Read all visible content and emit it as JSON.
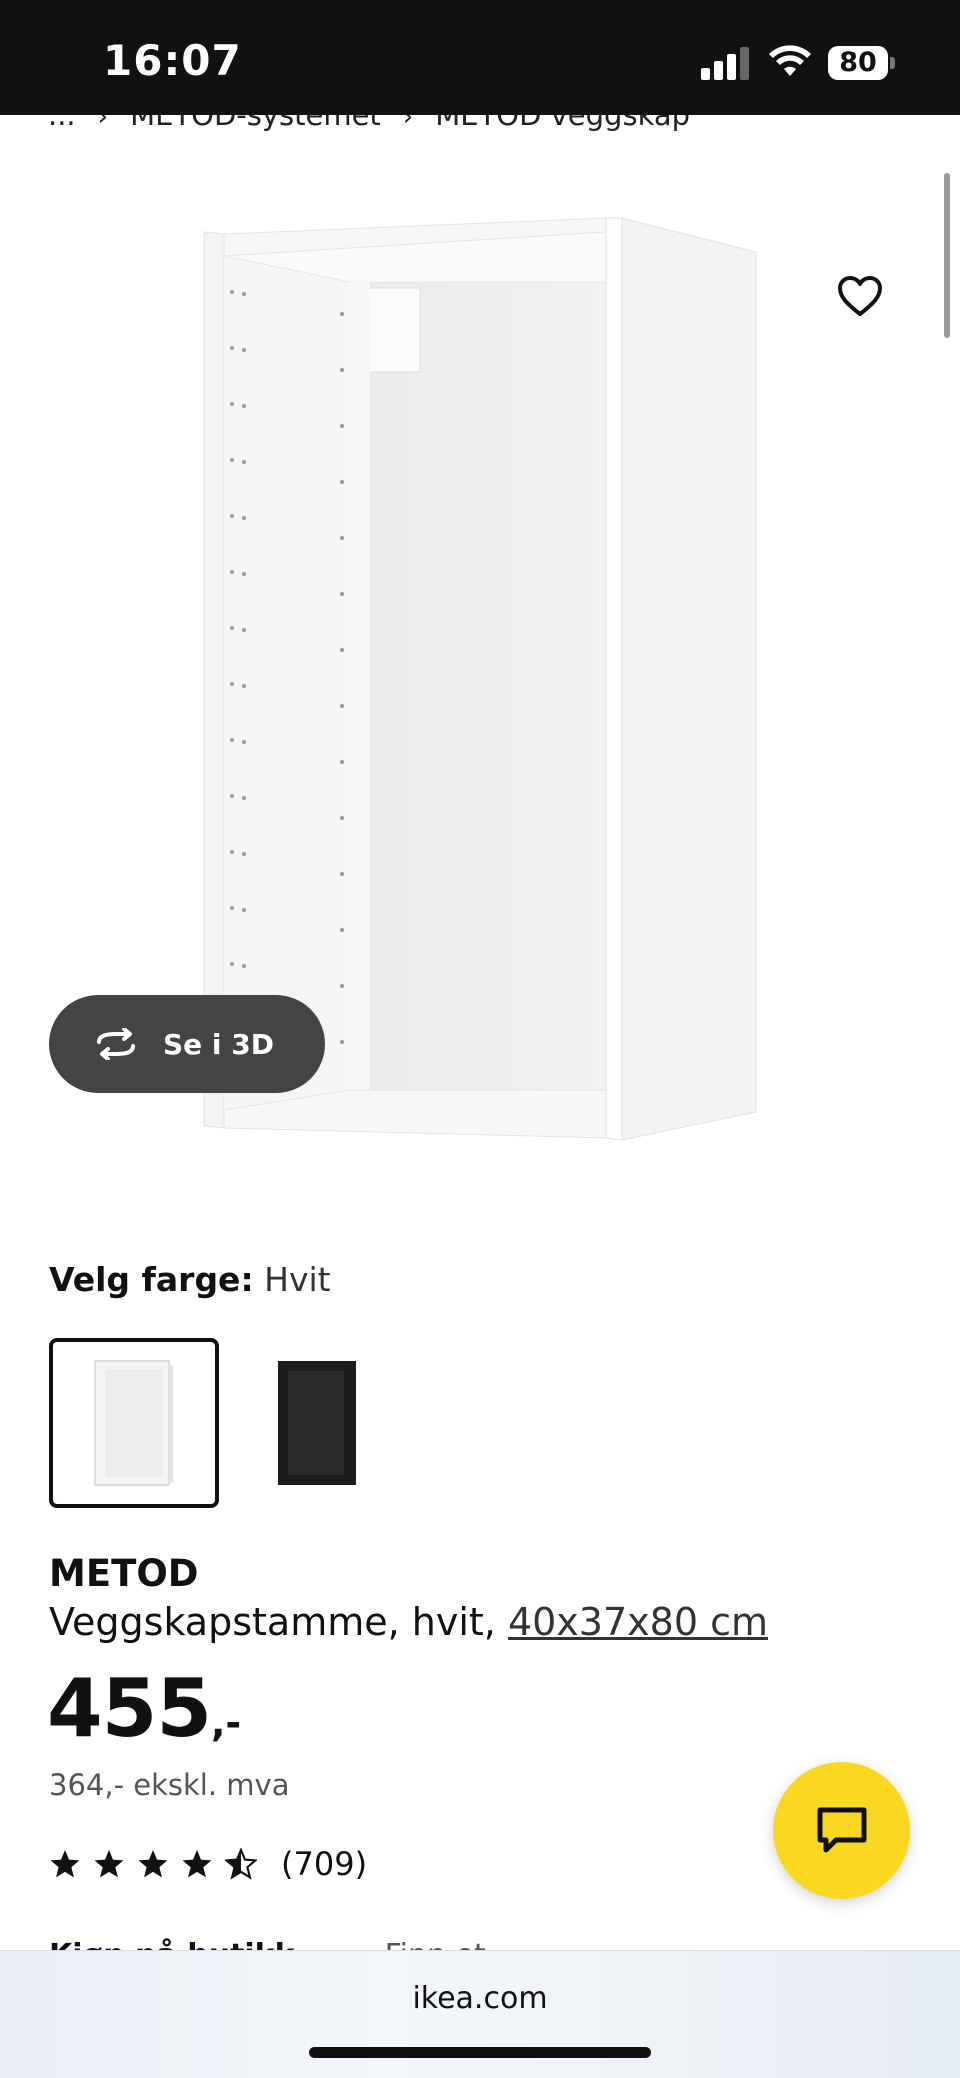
{
  "status_bar": {
    "time": "16:07",
    "battery": "80",
    "icons": [
      "signal-icon",
      "wifi-icon",
      "battery-icon"
    ]
  },
  "breadcrumb": {
    "items": [
      "...",
      "METOD-systemet",
      "METOD veggskap"
    ],
    "separator": "›"
  },
  "gallery": {
    "view_3d_label": "Se i 3D",
    "favorite_icon": "heart-outline-icon"
  },
  "color_selector": {
    "heading": "Velg farge:",
    "selected_value": "Hvit",
    "options": [
      "Hvit",
      "Svart"
    ]
  },
  "product": {
    "name": "METOD",
    "description": "Veggskapstamme, hvit, ",
    "dimensions": "40x37x80 cm",
    "price": "455",
    "price_suffix": ",-",
    "price_ex_vat": "364,- ekskl. mva",
    "rating_value": 4.5,
    "rating_count": "(709)"
  },
  "cutoff_row": {
    "label": "Kjøp på butikk",
    "value": "Finn et..."
  },
  "chat": {
    "icon": "chat-bubble-icon"
  },
  "browser": {
    "url": "ikea.com"
  },
  "colors": {
    "status_bar_bg": "#111111",
    "chat_button": "#fad820",
    "view3d_button": "#444444"
  }
}
